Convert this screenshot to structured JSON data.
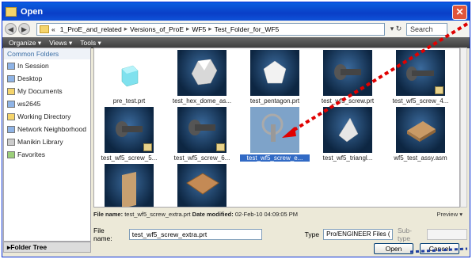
{
  "window": {
    "title": "Open",
    "close_glyph": "✕"
  },
  "address": {
    "back_glyph": "◀",
    "forward_glyph": "▶",
    "crumbs": [
      "1_ProE_and_related",
      "Versions_of_ProE",
      "WF5",
      "Test_Folder_for_WF5"
    ],
    "crumb_prefix": "«",
    "separator": "▸",
    "refresh_glyph": "▾ ↻",
    "search_placeholder": "Search"
  },
  "toolbar": {
    "organize": "Organize ▾",
    "views": "Views ▾",
    "tools": "Tools ▾"
  },
  "sidebar": {
    "header": "Common Folders",
    "items": [
      "In Session",
      "Desktop",
      "My Documents",
      "ws2645",
      "Working Directory",
      "Network Neighborhood",
      "Manikin Library",
      "Favorites"
    ],
    "folder_tree": "▸Folder Tree"
  },
  "files": [
    {
      "name": "pre_test.prt",
      "icon": "cube-icon"
    },
    {
      "name": "test_hex_dome_as...",
      "icon": "hex-dome-icon"
    },
    {
      "name": "test_pentagon.prt",
      "icon": "pentagon-icon"
    },
    {
      "name": "test_wf5_screw.prt",
      "icon": "screw-icon"
    },
    {
      "name": "test_wf5_screw_4...",
      "icon": "screw-icon"
    },
    {
      "name": "test_wf5_screw_5...",
      "icon": "screw-icon"
    },
    {
      "name": "test_wf5_screw_6...",
      "icon": "screw-icon"
    },
    {
      "name": "test_wf5_screw_e...",
      "icon": "screw-icon",
      "selected": true
    },
    {
      "name": "test_wf5_triangl...",
      "icon": "triangle-icon"
    },
    {
      "name": "wf5_test_assy.asm",
      "icon": "box-icon"
    },
    {
      "name": "",
      "icon": "plate-icon"
    },
    {
      "name": "",
      "icon": "tray-icon"
    }
  ],
  "info": {
    "filename_label": "File name:",
    "filename_value": "test_wf5_screw_extra.prt",
    "modified_label": "Date modified:",
    "modified_value": "02-Feb-10 04:09:05 PM",
    "preview": "Preview ▾"
  },
  "form": {
    "filename_label": "File name:",
    "filename_value": "test_wf5_screw_extra.prt",
    "type_label": "Type",
    "type_value": "Pro/ENGINEER Files (",
    "subtype_label": "Sub-type"
  },
  "buttons": {
    "open": "Open",
    "cancel": "Cancel"
  },
  "colors": {
    "title_bar": "#0a3fc7",
    "selection": "#316ac5",
    "arrow": "#e00000"
  }
}
